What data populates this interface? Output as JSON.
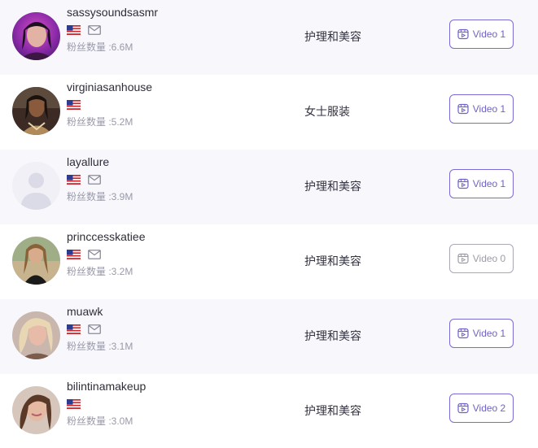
{
  "creators": [
    {
      "username": "sassysoundsasmr",
      "country": "us-flag",
      "followers": "粉丝数量 :6.6M",
      "category": "护理和美容",
      "video_label": "Video 1",
      "has_mail": true,
      "video_enabled": true,
      "avatar_type": "photo-purple"
    },
    {
      "username": "virginiasanhouse",
      "country": "us-flag",
      "followers": "粉丝数量 :5.2M",
      "category": "女士服装",
      "video_label": "Video 1",
      "has_mail": false,
      "video_enabled": true,
      "avatar_type": "photo-dark"
    },
    {
      "username": "layallure",
      "country": "us-flag",
      "followers": "粉丝数量 :3.9M",
      "category": "护理和美容",
      "video_label": "Video 1",
      "has_mail": true,
      "video_enabled": true,
      "avatar_type": "placeholder"
    },
    {
      "username": "princcesskatiee",
      "country": "us-flag",
      "followers": "粉丝数量 :3.2M",
      "category": "护理和美容",
      "video_label": "Video 0",
      "has_mail": true,
      "video_enabled": false,
      "avatar_type": "photo-outdoor"
    },
    {
      "username": "muawk",
      "country": "us-flag",
      "followers": "粉丝数量 :3.1M",
      "category": "护理和美容",
      "video_label": "Video 1",
      "has_mail": true,
      "video_enabled": true,
      "avatar_type": "photo-blonde"
    },
    {
      "username": "bilintinamakeup",
      "country": "us-flag",
      "followers": "粉丝数量 :3.0M",
      "category": "护理和美容",
      "video_label": "Video 2",
      "has_mail": false,
      "video_enabled": true,
      "avatar_type": "photo-brunette"
    }
  ],
  "colors": {
    "accent": "#7a6cd6",
    "alt_row": "#f7f7fc"
  }
}
